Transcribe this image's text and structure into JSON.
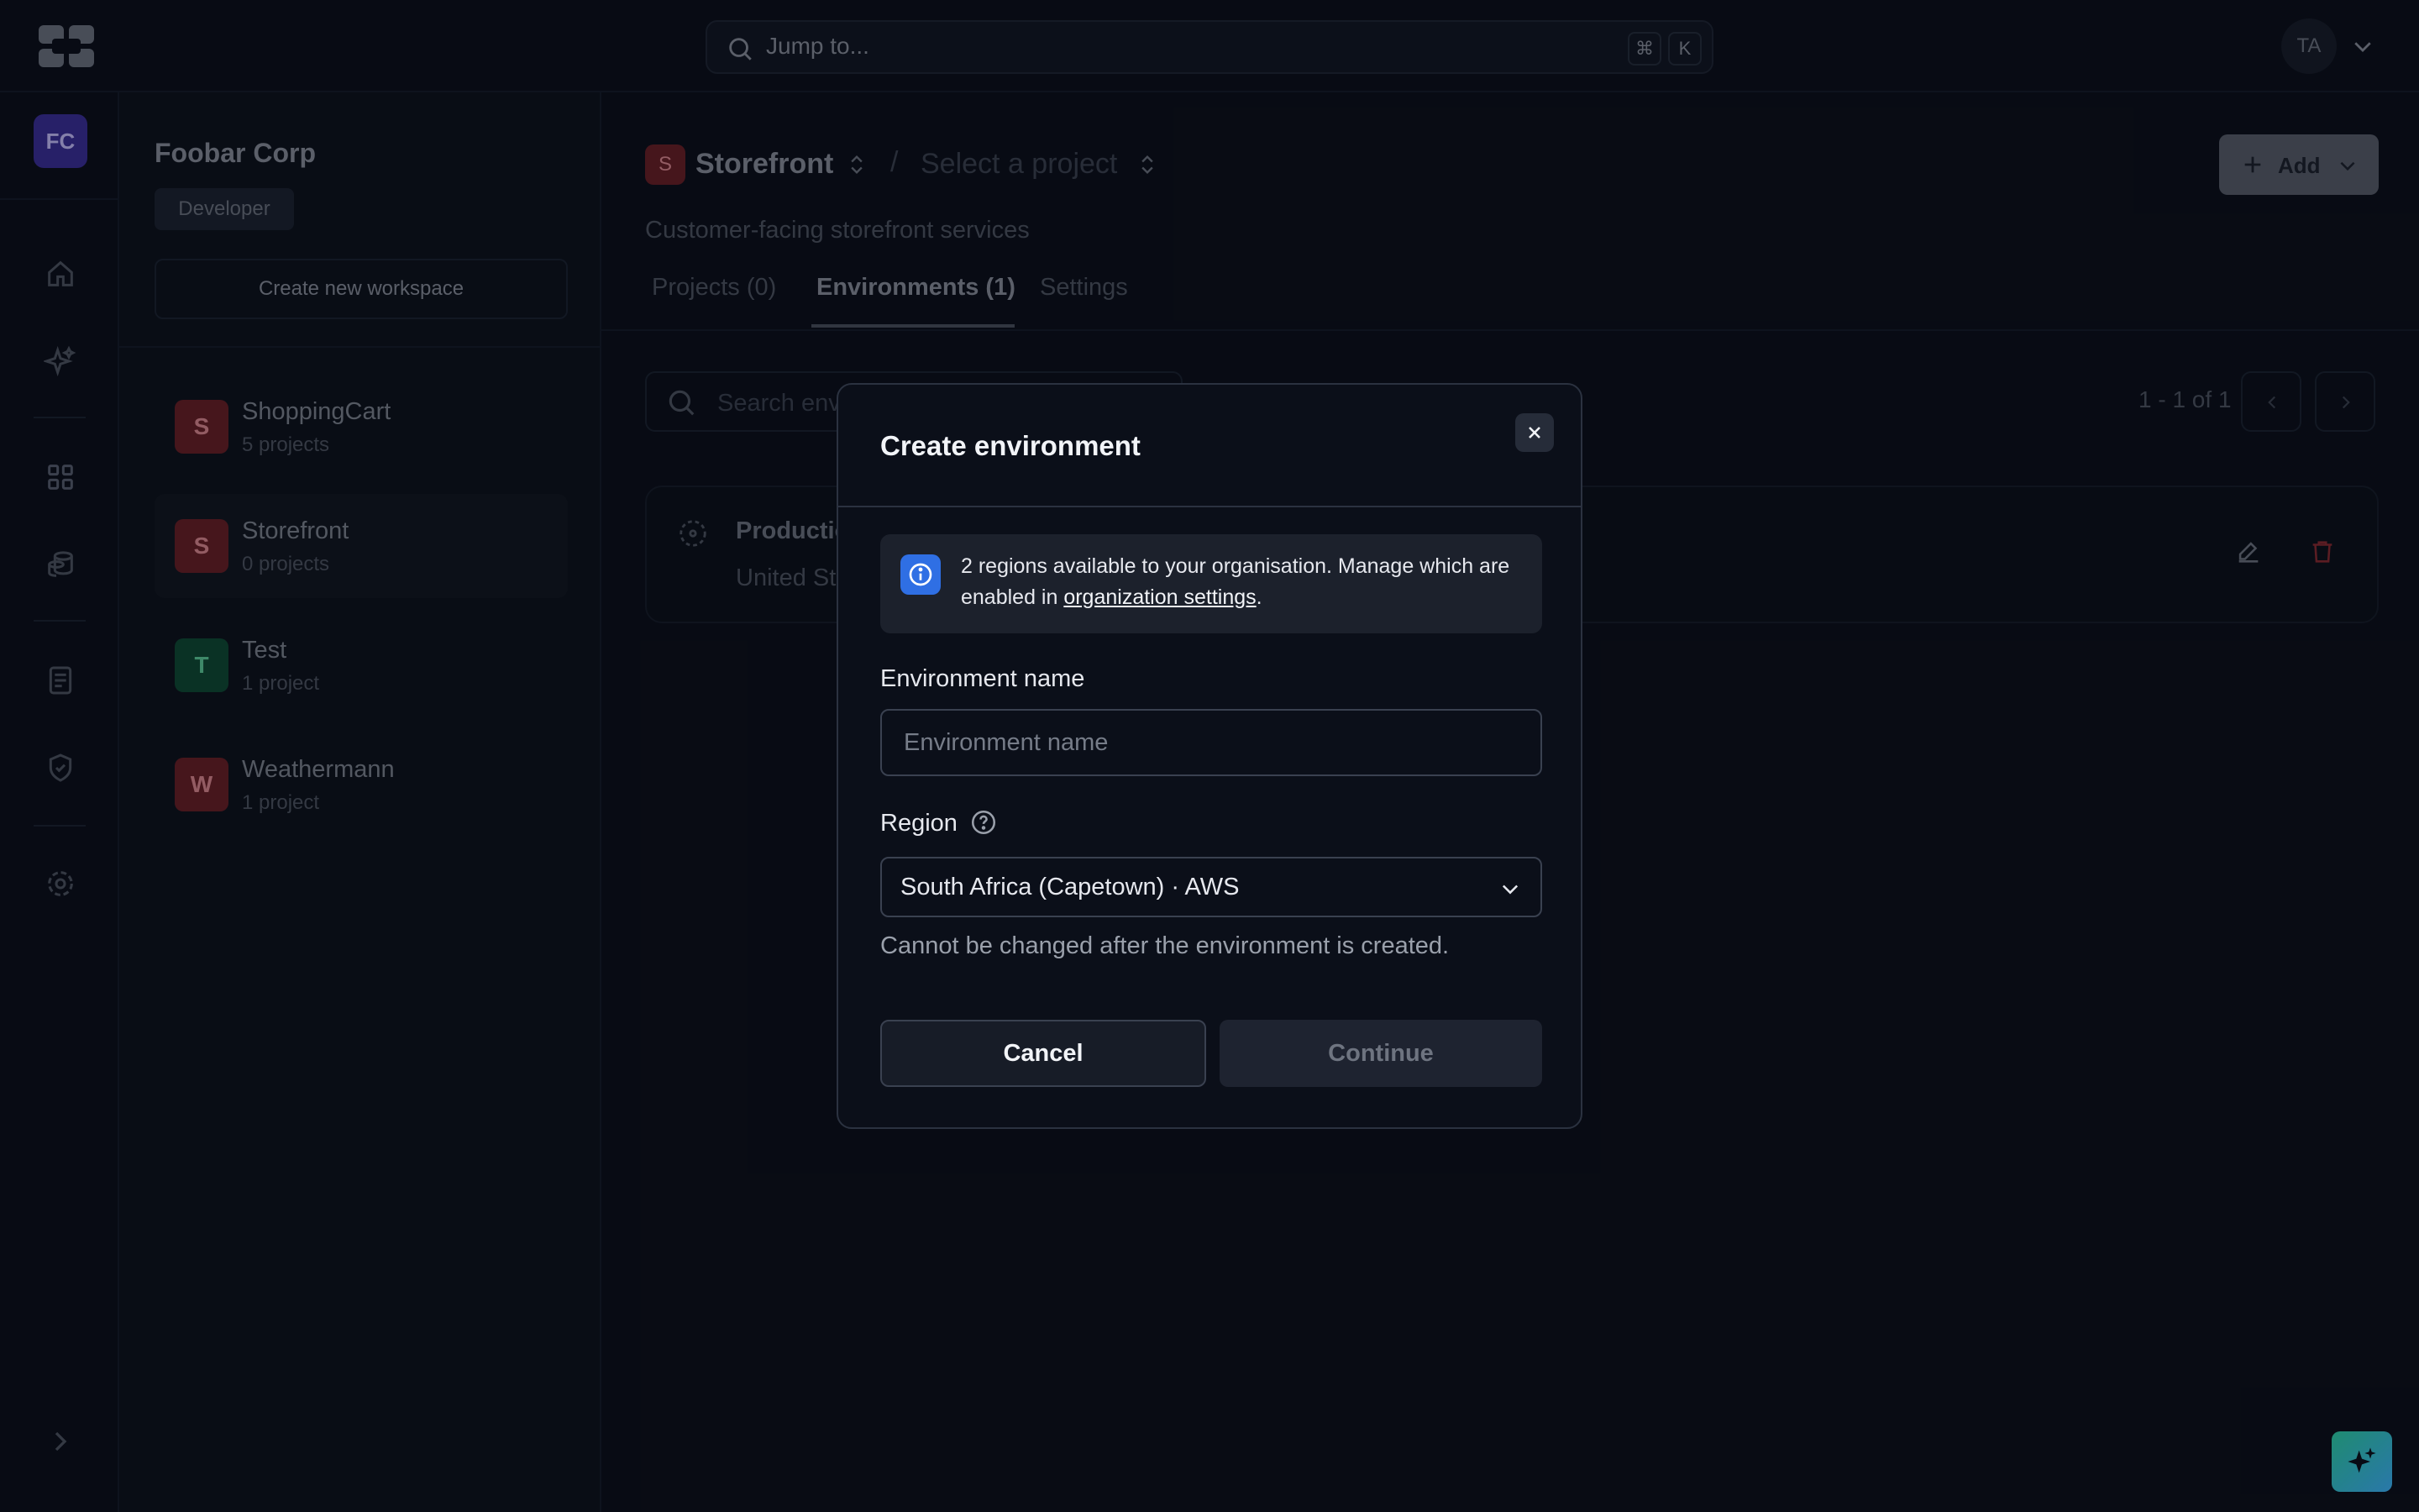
{
  "topbar": {
    "search_placeholder": "Jump to...",
    "shortcut_keys": [
      "⌘",
      "K"
    ],
    "user_initials": "TA"
  },
  "rail": {
    "workspace_initials": "FC",
    "icons": [
      "home-icon",
      "sparkle-icon",
      "grid-icon",
      "database-icon",
      "document-icon",
      "shield-check-icon",
      "gear-icon",
      "chevron-right-icon"
    ]
  },
  "sidebar": {
    "org_name": "Foobar Corp",
    "role": "Developer",
    "create_workspace_label": "Create new workspace",
    "workspaces": [
      {
        "letter": "S",
        "name": "ShoppingCart",
        "sub": "5 projects",
        "color": "#6b1f26",
        "text_color": "#e08a92"
      },
      {
        "letter": "S",
        "name": "Storefront",
        "sub": "0 projects",
        "color": "#6b1f26",
        "text_color": "#e08a92"
      },
      {
        "letter": "T",
        "name": "Test",
        "sub": "1 project",
        "color": "#0f4a34",
        "text_color": "#5fcf9c"
      },
      {
        "letter": "W",
        "name": "Weathermann",
        "sub": "1 project",
        "color": "#6b1f26",
        "text_color": "#e08a92"
      }
    ]
  },
  "main": {
    "breadcrumb": {
      "workspace_letter": "S",
      "workspace": "Storefront",
      "separator": "/",
      "project": "Select a project"
    },
    "add_label": "Add",
    "description": "Customer-facing storefront services",
    "tabs": [
      {
        "label": "Projects (0)"
      },
      {
        "label": "Environments (1)"
      },
      {
        "label": "Settings"
      }
    ],
    "search_placeholder": "Search env",
    "pager_text": "1 - 1 of 1",
    "environment": {
      "name": "Productio",
      "region": "United St"
    }
  },
  "modal": {
    "title": "Create environment",
    "info_text": "2 regions available to your organisation. Manage which are enabled in ",
    "info_link": "organization settings",
    "info_suffix": ".",
    "name_label": "Environment name",
    "name_placeholder": "Environment name",
    "region_label": "Region",
    "region_value": "South Africa (Capetown) · AWS",
    "region_hint": "Cannot be changed after the environment is created.",
    "cancel_label": "Cancel",
    "continue_label": "Continue"
  },
  "colors": {
    "accent": "#2f6fe4",
    "background": "#0b0f19",
    "danger": "#8a2a30"
  }
}
